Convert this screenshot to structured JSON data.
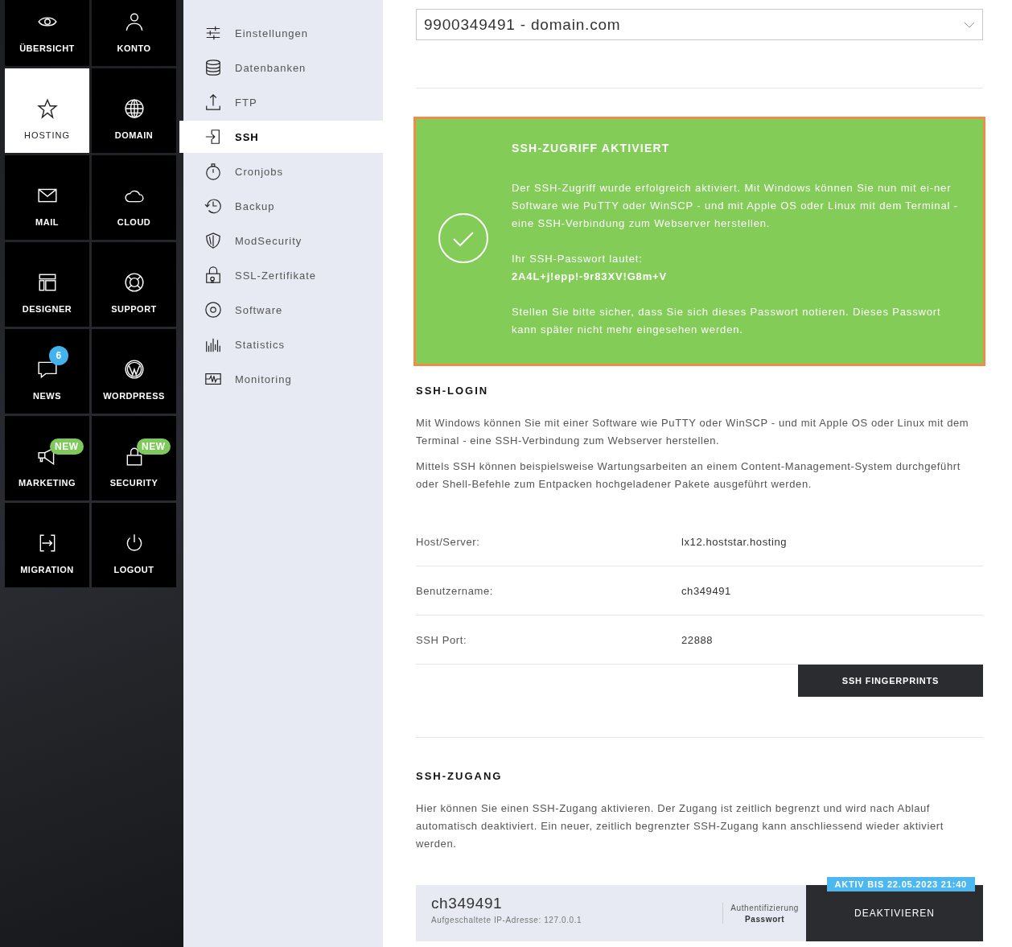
{
  "main_nav": [
    {
      "label": "ÜBERSICHT",
      "selected": false
    },
    {
      "label": "KONTO",
      "selected": false
    },
    {
      "label": "HOSTING",
      "selected": true
    },
    {
      "label": "DOMAIN",
      "selected": false
    },
    {
      "label": "MAIL",
      "selected": false
    },
    {
      "label": "CLOUD",
      "selected": false
    },
    {
      "label": "DESIGNER",
      "selected": false
    },
    {
      "label": "SUPPORT",
      "selected": false
    },
    {
      "label": "NEWS",
      "selected": false,
      "badge": {
        "text": "6",
        "kind": "count"
      }
    },
    {
      "label": "WORDPRESS",
      "selected": false
    },
    {
      "label": "MARKETING",
      "selected": false,
      "badge": {
        "text": "NEW",
        "kind": "new"
      }
    },
    {
      "label": "SECURITY",
      "selected": false,
      "badge": {
        "text": "NEW",
        "kind": "new"
      }
    },
    {
      "label": "MIGRATION",
      "selected": false
    },
    {
      "label": "LOGOUT",
      "selected": false
    }
  ],
  "sub_nav": [
    {
      "label": "Einstellungen",
      "selected": false
    },
    {
      "label": "Datenbanken",
      "selected": false
    },
    {
      "label": "FTP",
      "selected": false
    },
    {
      "label": "SSH",
      "selected": true
    },
    {
      "label": "Cronjobs",
      "selected": false
    },
    {
      "label": "Backup",
      "selected": false
    },
    {
      "label": "ModSecurity",
      "selected": false
    },
    {
      "label": "SSL-Zertifikate",
      "selected": false
    },
    {
      "label": "Software",
      "selected": false
    },
    {
      "label": "Statistics",
      "selected": false
    },
    {
      "label": "Monitoring",
      "selected": false
    }
  ],
  "domain_select": {
    "value": "9900349491 - domain.com"
  },
  "alert": {
    "title": "SSH-ZUGRIFF AKTIVIERT",
    "message": "Der SSH-Zugriff wurde erfolgreich aktiviert. Mit Windows können Sie nun mit ei-ner Software wie PuTTY oder WinSCP - und mit Apple OS oder Linux mit dem Terminal - eine SSH-Verbindung zum Webserver herstellen.",
    "password_label": "Ihr SSH-Passwort lautet:",
    "password": "2A4L+j!epp!-9r83XV!G8m+V",
    "note": "Stellen Sie bitte sicher, dass Sie sich dieses Passwort notieren. Dieses Passwort kann später nicht mehr eingesehen werden."
  },
  "ssh_login": {
    "title": "SSH-LOGIN",
    "paragraphs": [
      "Mit Windows können Sie mit einer Software wie PuTTY oder WinSCP - und mit Apple OS oder Linux mit dem Terminal - eine SSH-Verbindung zum Webserver herstellen.",
      "Mittels SSH können beispielsweise Wartungsarbeiten an einem Content-Management-System durchgeführt oder Shell-Befehle zum Entpacken hochgeladener Pakete ausgeführt werden."
    ],
    "fields": [
      {
        "label": "Host/Server:",
        "value": "lx12.hoststar.hosting"
      },
      {
        "label": "Benutzername:",
        "value": "ch349491"
      },
      {
        "label": "SSH Port:",
        "value": "22888"
      }
    ],
    "button": "SSH FINGERPRINTS"
  },
  "ssh_access": {
    "title": "SSH-ZUGANG",
    "description": "Hier können Sie einen SSH-Zugang aktivieren. Der Zugang ist zeitlich begrenzt und wird nach Ablauf automatisch deaktiviert. Ein neuer, zeitlich begrenzter SSH-Zugang kann anschliessend wieder aktiviert werden.",
    "entry": {
      "user": "ch349491",
      "ip": "Aufgeschaltete IP-Adresse: 127.0.0.1",
      "auth_label": "Authentifizierung",
      "auth_value": "Passwort",
      "status": "AKTIV BIS 22.05.2023 21:40",
      "button": "DEAKTIVIEREN"
    }
  }
}
